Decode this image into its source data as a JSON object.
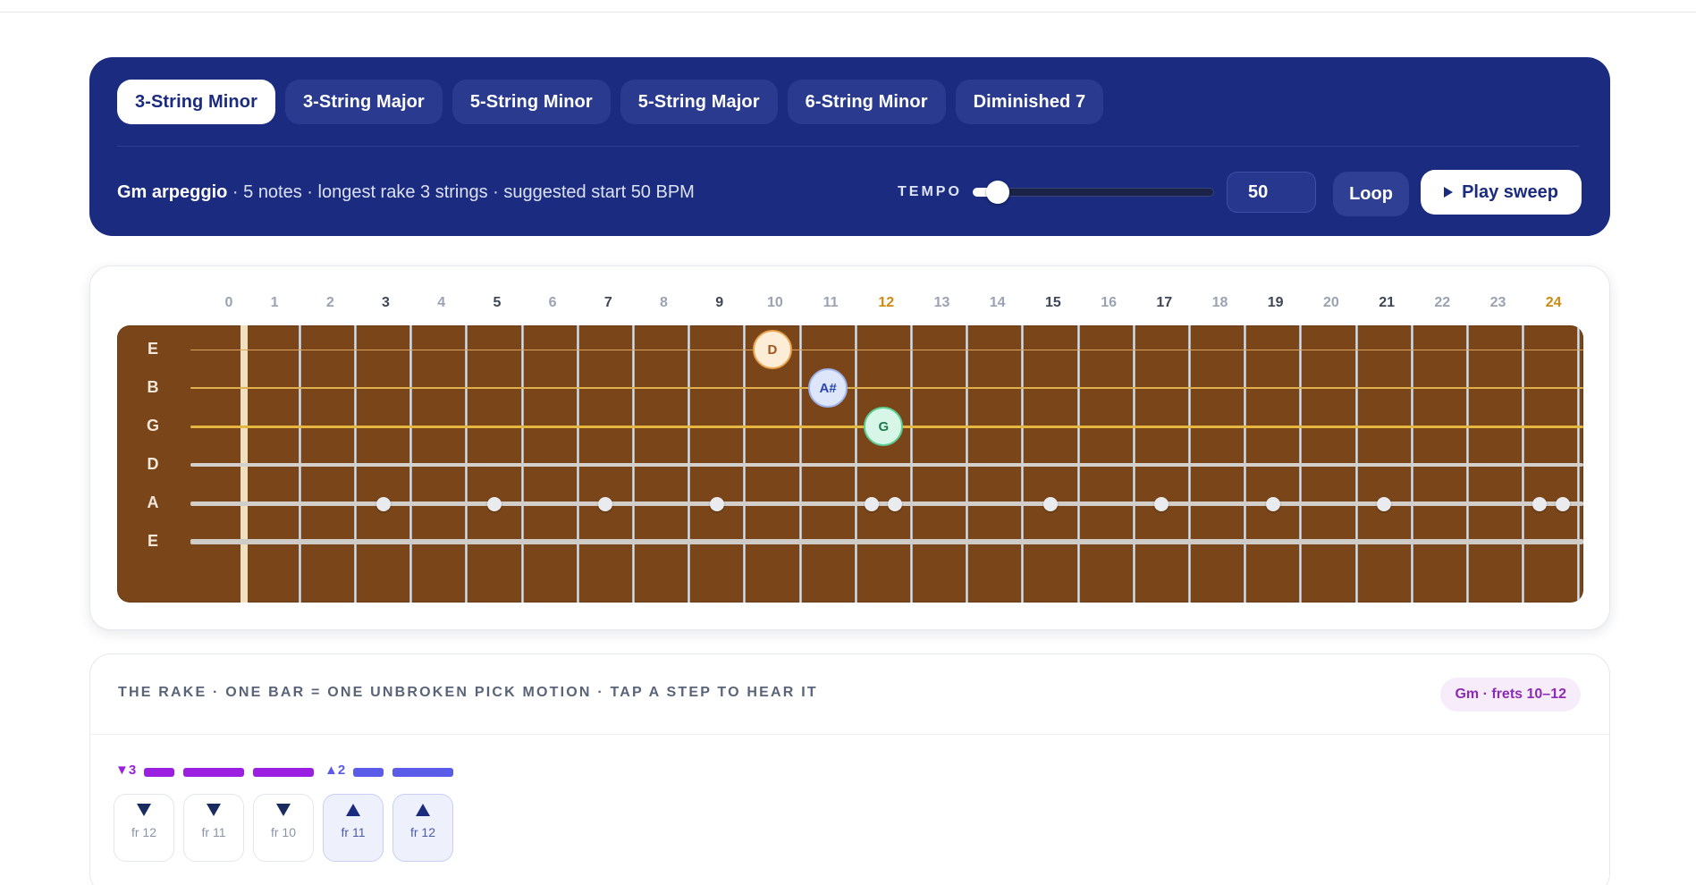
{
  "tabs": [
    {
      "label": "3-String Minor",
      "active": true
    },
    {
      "label": "3-String Major",
      "active": false
    },
    {
      "label": "5-String Minor",
      "active": false
    },
    {
      "label": "5-String Major",
      "active": false
    },
    {
      "label": "6-String Minor",
      "active": false
    },
    {
      "label": "Diminished 7",
      "active": false
    }
  ],
  "summary": {
    "arpeggio": "Gm arpeggio",
    "details": " · 5 notes · longest rake 3 strings · suggested start 50 BPM"
  },
  "tempo": {
    "label": "TEMPO",
    "value": "50",
    "slider_fraction": 0.06
  },
  "buttons": {
    "loop": "Loop",
    "play": "Play sweep"
  },
  "fretboard": {
    "fret_numbers": [
      "0",
      "1",
      "2",
      "3",
      "4",
      "5",
      "6",
      "7",
      "8",
      "9",
      "10",
      "11",
      "12",
      "13",
      "14",
      "15",
      "16",
      "17",
      "18",
      "19",
      "20",
      "21",
      "22",
      "23",
      "24"
    ],
    "inlay_frets": [
      3,
      5,
      7,
      9,
      15,
      17,
      19,
      21
    ],
    "octave_frets": [
      12,
      24
    ],
    "strings": [
      {
        "label": "E",
        "color": "#d9a560",
        "thickness": 1
      },
      {
        "label": "B",
        "color": "#e0b04f",
        "thickness": 2
      },
      {
        "label": "G",
        "color": "#e6b740",
        "thickness": 3
      },
      {
        "label": "D",
        "color": "#d4d0cc",
        "thickness": 4
      },
      {
        "label": "A",
        "color": "#d2cfcb",
        "thickness": 5
      },
      {
        "label": "E",
        "color": "#cfccc8",
        "thickness": 6
      }
    ],
    "notes": [
      {
        "name": "D",
        "string": 0,
        "fret": 10,
        "bg": "#fdecd6",
        "border": "#e8a24c",
        "text": "#a3541a"
      },
      {
        "name": "A#",
        "string": 1,
        "fret": 11,
        "bg": "#dde6fb",
        "border": "#9fb4ee",
        "text": "#2c46a8"
      },
      {
        "name": "G",
        "string": 2,
        "fret": 12,
        "bg": "#d8f6e8",
        "border": "#5ccf94",
        "text": "#1c7a4e"
      }
    ]
  },
  "rake": {
    "title": "THE RAKE · ONE BAR = ONE UNBROKEN PICK MOTION · TAP A STEP TO HEAR IT",
    "badge": "Gm · frets 10–12",
    "groups": [
      {
        "direction": "down",
        "symbol": "▼3",
        "color": "#9b1fe0",
        "count": 3
      },
      {
        "direction": "up",
        "symbol": "▲2",
        "color": "#5a5be8",
        "count": 2
      }
    ],
    "steps": [
      {
        "direction": "down",
        "fret": "fr 12"
      },
      {
        "direction": "down",
        "fret": "fr 11"
      },
      {
        "direction": "down",
        "fret": "fr 10"
      },
      {
        "direction": "up",
        "fret": "fr 11"
      },
      {
        "direction": "up",
        "fret": "fr 12"
      }
    ]
  }
}
